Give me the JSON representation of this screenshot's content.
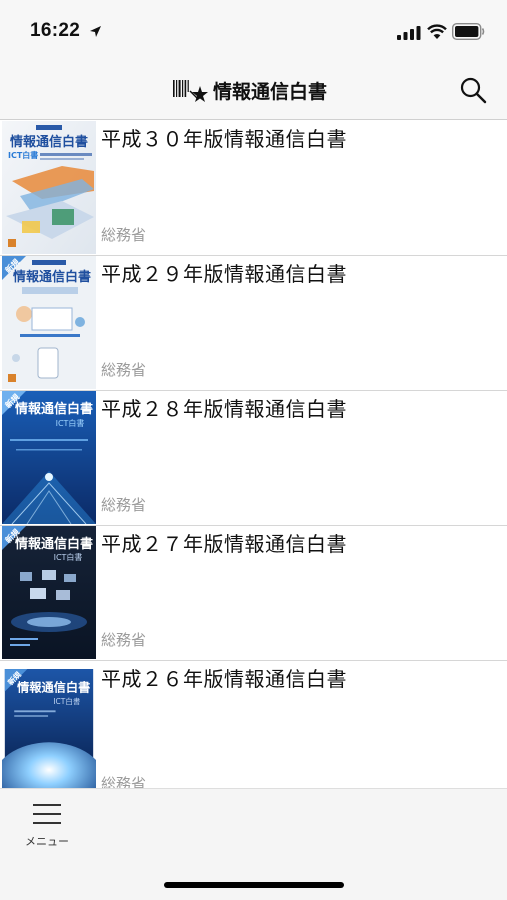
{
  "status_bar": {
    "time": "16:22",
    "icons": [
      "location-arrow-icon",
      "signal-icon",
      "wifi-icon",
      "battery-icon"
    ]
  },
  "nav": {
    "title": "情報通信白書",
    "logo_icon": "barcode-star-icon",
    "search_icon": "search-icon"
  },
  "books": [
    {
      "title": "平成３０年版情報通信白書",
      "publisher": "総務省",
      "cover": {
        "banner": "情報通信白書",
        "sub": "ICT白書",
        "theme": "light",
        "new_badge": ""
      }
    },
    {
      "title": "平成２９年版情報通信白書",
      "publisher": "総務省",
      "cover": {
        "banner": "情報通信白書",
        "sub": "",
        "theme": "light",
        "new_badge": "新規"
      }
    },
    {
      "title": "平成２８年版情報通信白書",
      "publisher": "総務省",
      "cover": {
        "banner": "情報通信白書",
        "sub": "ICT白書",
        "theme": "blue",
        "new_badge": "新規"
      }
    },
    {
      "title": "平成２７年版情報通信白書",
      "publisher": "総務省",
      "cover": {
        "banner": "情報通信白書",
        "sub": "ICT白書",
        "theme": "dark",
        "new_badge": "新規"
      }
    },
    {
      "title": "平成２６年版情報通信白書",
      "publisher": "総務省",
      "cover": {
        "banner": "情報通信白書",
        "sub": "ICT白書",
        "theme": "earth",
        "new_badge": "新規"
      }
    }
  ],
  "tab_bar": {
    "menu_label": "メニュー",
    "menu_icon": "hamburger-menu-icon"
  }
}
